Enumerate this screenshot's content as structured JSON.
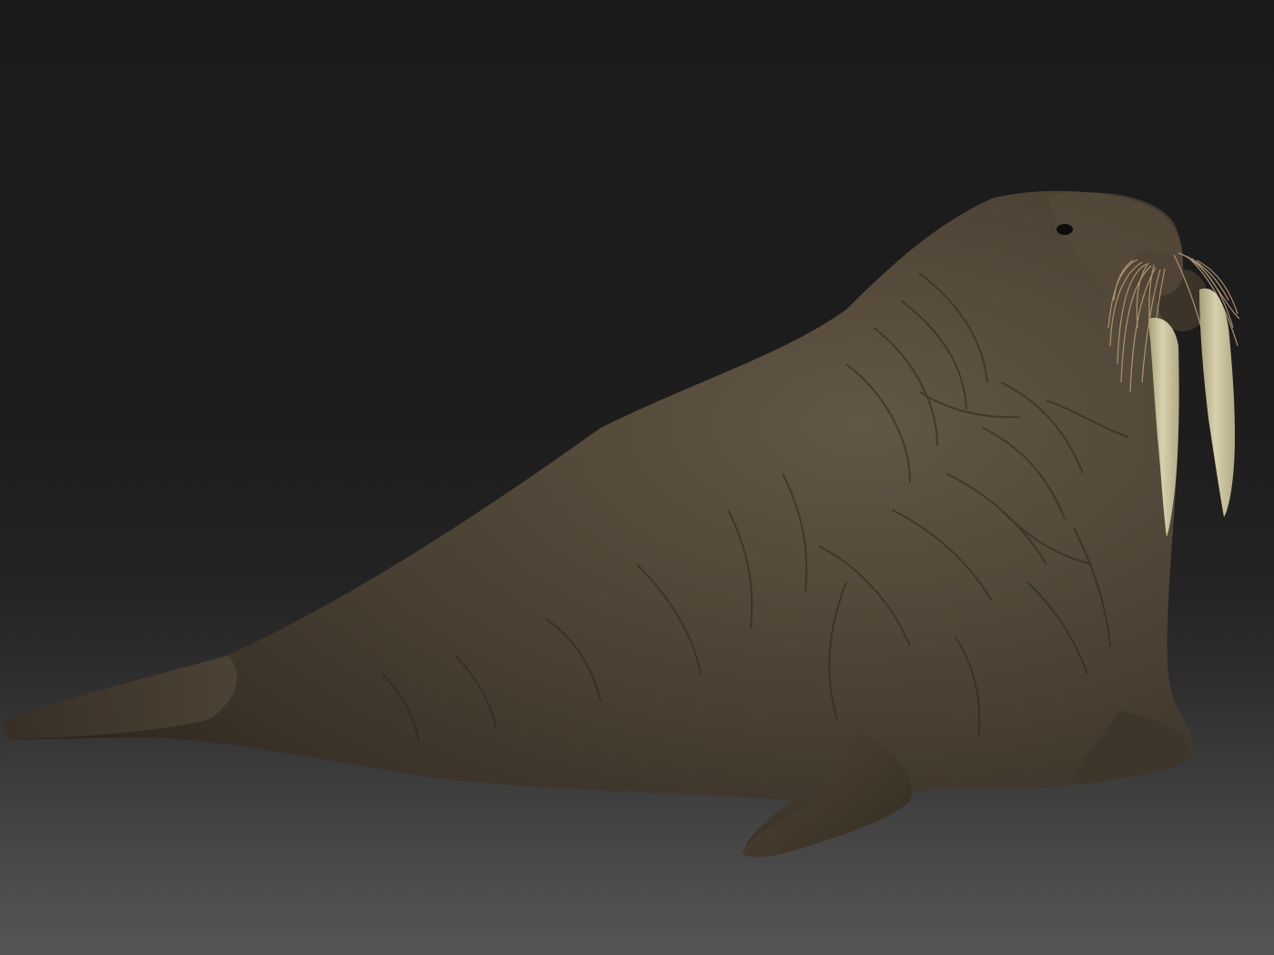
{
  "scene": {
    "subject": "walrus",
    "colors": {
      "background_top": "#1b1b1b",
      "background_bottom": "#555555",
      "body": "#4a4033",
      "body_highlight": "#5d5141",
      "body_shadow": "#2e271e",
      "tusk": "#cfc7a0",
      "whisker": "#b89a78",
      "eye": "#0c0c10"
    }
  }
}
